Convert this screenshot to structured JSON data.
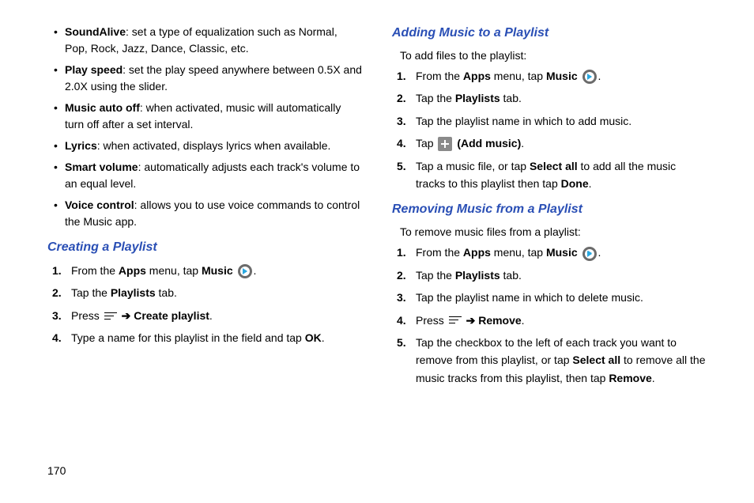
{
  "pageNum": "170",
  "left": {
    "bullets": [
      {
        "term": "SoundAlive",
        "desc": ": set a type of equalization such as Normal, Pop, Rock, Jazz, Dance, Classic, etc."
      },
      {
        "term": "Play speed",
        "desc": ": set the play speed anywhere between 0.5X and 2.0X using the slider."
      },
      {
        "term": "Music auto off",
        "desc": ": when activated, music will automatically turn off after a set interval."
      },
      {
        "term": "Lyrics",
        "desc": ": when activated, displays lyrics when available."
      },
      {
        "term": "Smart volume",
        "desc": ": automatically adjusts each track's volume to an equal level."
      },
      {
        "term": "Voice control",
        "desc": ": allows you to use voice commands to control the Music app."
      }
    ],
    "h_creating": "Creating a Playlist",
    "creating": [
      {
        "n": "1.",
        "pre": "From the ",
        "b1": "Apps",
        "mid": " menu, tap ",
        "b2": "Music",
        "end": "."
      },
      {
        "n": "2.",
        "pre": "Tap the ",
        "b1": "Playlists",
        "end": " tab."
      },
      {
        "n": "3.",
        "pre": "Press ",
        "b1": "Create playlist",
        "end": "."
      },
      {
        "n": "4.",
        "pre": "Type a name for this playlist in the field and tap ",
        "b1": "OK",
        "end": "."
      }
    ]
  },
  "right": {
    "h_adding": "Adding Music to a Playlist",
    "intro_add": "To add files to the playlist:",
    "adding": [
      {
        "n": "1.",
        "pre": "From the ",
        "b1": "Apps",
        "mid": " menu, tap ",
        "b2": "Music",
        "end": "."
      },
      {
        "n": "2.",
        "pre": "Tap the ",
        "b1": "Playlists",
        "end": " tab."
      },
      {
        "n": "3.",
        "pre": "Tap the playlist name in which to add music."
      },
      {
        "n": "4.",
        "pre": "Tap ",
        "b1": "(Add music)",
        "end": "."
      },
      {
        "n": "5.",
        "pre": "Tap a music file, or tap ",
        "b1": "Select all",
        "mid": " to add all the music tracks to this playlist then tap ",
        "b2": "Done",
        "end": "."
      }
    ],
    "h_removing": "Removing Music from a Playlist",
    "intro_rem": "To remove music files from a playlist:",
    "removing": [
      {
        "n": "1.",
        "pre": "From the ",
        "b1": "Apps",
        "mid": " menu, tap ",
        "b2": "Music",
        "end": "."
      },
      {
        "n": "2.",
        "pre": "Tap the ",
        "b1": "Playlists",
        "end": " tab."
      },
      {
        "n": "3.",
        "pre": "Tap the playlist name in which to delete music."
      },
      {
        "n": "4.",
        "pre": "Press ",
        "b1": "Remove",
        "end": "."
      },
      {
        "n": "5.",
        "pre": "Tap the checkbox to the left of each track you want to remove from this playlist, or tap ",
        "b1": "Select all",
        "mid": " to remove all the music tracks from this playlist, then tap ",
        "b2": "Remove",
        "end": "."
      }
    ]
  },
  "arrow": "➔"
}
